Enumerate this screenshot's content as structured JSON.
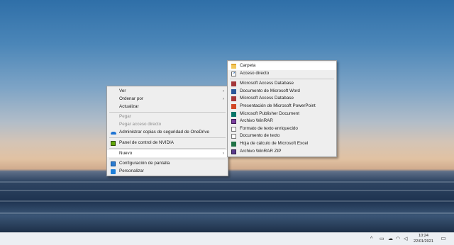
{
  "context_menu": {
    "items": [
      {
        "label": "Ver",
        "arrow": "›"
      },
      {
        "label": "Ordenar por",
        "arrow": "›"
      },
      {
        "label": "Actualizar"
      },
      {
        "label": "Pegar"
      },
      {
        "label": "Pegar acceso directo"
      },
      {
        "label": "Administrar copias de seguridad de OneDrive",
        "icon": "onedrive-icon"
      },
      {
        "label": "Panel de control de NVIDIA",
        "icon": "nvidia-icon"
      },
      {
        "label": "Nuevo",
        "arrow": "›"
      },
      {
        "label": "Configuración de pantalla",
        "icon": "display-settings-icon"
      },
      {
        "label": "Personalizar",
        "icon": "personalize-icon"
      }
    ]
  },
  "submenu": {
    "items": [
      {
        "label": "Carpeta",
        "icon": "folder-icon"
      },
      {
        "label": "Acceso directo",
        "icon": "shortcut-icon"
      },
      {
        "label": "Microsoft Access Database",
        "icon": "access-icon"
      },
      {
        "label": "Documento de Microsoft Word",
        "icon": "word-icon"
      },
      {
        "label": "Microsoft Access Database",
        "icon": "access-icon"
      },
      {
        "label": "Presentación de Microsoft PowerPoint",
        "icon": "powerpoint-icon"
      },
      {
        "label": "Microsoft Publisher Document",
        "icon": "publisher-icon"
      },
      {
        "label": "Archivo WinRAR",
        "icon": "winrar-icon"
      },
      {
        "label": "Formato de texto enriquecido",
        "icon": "rtf-document-icon"
      },
      {
        "label": "Documento de texto",
        "icon": "text-document-icon"
      },
      {
        "label": "Hoja de cálculo de Microsoft Excel",
        "icon": "excel-icon"
      },
      {
        "label": "Archivo WinRAR ZIP",
        "icon": "winrar-zip-icon"
      }
    ]
  },
  "taskbar": {
    "clock": {
      "time": "10:24",
      "date": "22/01/2021"
    },
    "tray_icons": [
      "chevron-up-icon",
      "network-icon",
      "onedrive-tray-icon",
      "wifi-icon",
      "volume-icon"
    ],
    "action_center": "notifications-icon"
  },
  "colors": {
    "menu_bg": "#eeeeee",
    "highlight": "#ffffff",
    "disabled_text": "#8c8c8c",
    "taskbar_bg": "#eceff3"
  }
}
